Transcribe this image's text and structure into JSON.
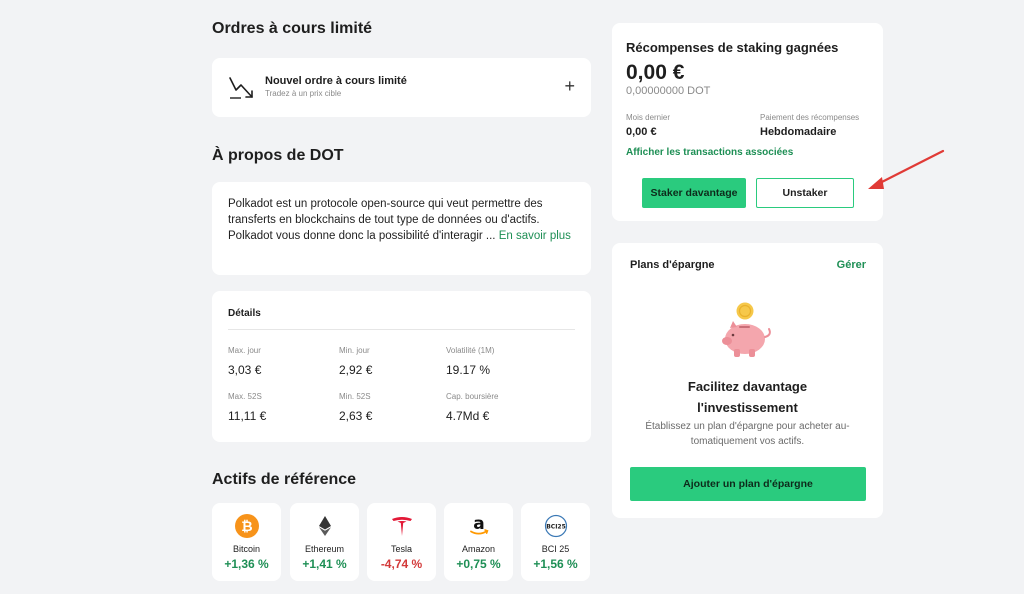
{
  "limit_orders": {
    "heading": "Ordres à cours limité",
    "new_title": "Nouvel ordre à cours limité",
    "new_subtitle": "Tradez à un prix cible",
    "icon": "chart-arrow-icon",
    "add_icon": "plus-icon"
  },
  "about": {
    "heading": "À propos de DOT",
    "text": "Polkadot est un protocole open-source qui veut permettre des transferts en blockchains de tout type de données ou d'actifs. Polkadot vous donne donc la possibilité d'interagir ... ",
    "more_label": "En savoir plus"
  },
  "details": {
    "heading": "Détails",
    "stats": [
      {
        "label": "Max. jour",
        "value": "3,03 €"
      },
      {
        "label": "Min. jour",
        "value": "2,92 €"
      },
      {
        "label": "Volatilité (1M)",
        "value": "19.17 %"
      },
      {
        "label": "Max. 52S",
        "value": "11,11 €"
      },
      {
        "label": "Min. 52S",
        "value": "2,63 €"
      },
      {
        "label": "Cap. boursière",
        "value": "4.7Md €"
      }
    ]
  },
  "reference_assets": {
    "heading": "Actifs de référence",
    "items": [
      {
        "name": "Bitcoin",
        "change": "+1,36 %",
        "icon": "bitcoin-icon",
        "direction": "up"
      },
      {
        "name": "Ethereum",
        "change": "+1,41 %",
        "icon": "ethereum-icon",
        "direction": "up"
      },
      {
        "name": "Tesla",
        "change": "-4,74 %",
        "icon": "tesla-icon",
        "direction": "down"
      },
      {
        "name": "Amazon",
        "change": "+0,75 %",
        "icon": "amazon-icon",
        "direction": "up"
      },
      {
        "name": "BCI 25",
        "change": "+1,56 %",
        "icon": "bci25-icon",
        "direction": "up",
        "icon_text": "BCI25"
      }
    ]
  },
  "staking": {
    "title": "Récompenses de staking gagnées",
    "amount": "0,00 €",
    "amount_dot": "0,00000000 DOT",
    "last_month_label": "Mois dernier",
    "last_month_value": "0,00 €",
    "payout_label": "Paiement des récompenses",
    "payout_value": "Hebdomadaire",
    "transactions_link": "Afficher les transactions associées",
    "stake_more_button": "Staker davantage",
    "unstake_button": "Unstaker"
  },
  "savings_plans": {
    "heading": "Plans d'épargne",
    "manage_link": "Gérer",
    "promo_title_1": "Facilitez davantage",
    "promo_title_2": "l'investissement",
    "promo_text": "Établissez un plan d'épargne pour acheter au-tomatiquement vos actifs.",
    "add_button": "Ajouter un plan d'épargne",
    "illustration": "piggy-bank-icon"
  },
  "colors": {
    "accent": "#2acb7e",
    "link": "#1e8f55",
    "negative": "#d33a3a",
    "annotation_arrow": "#e03a36"
  }
}
